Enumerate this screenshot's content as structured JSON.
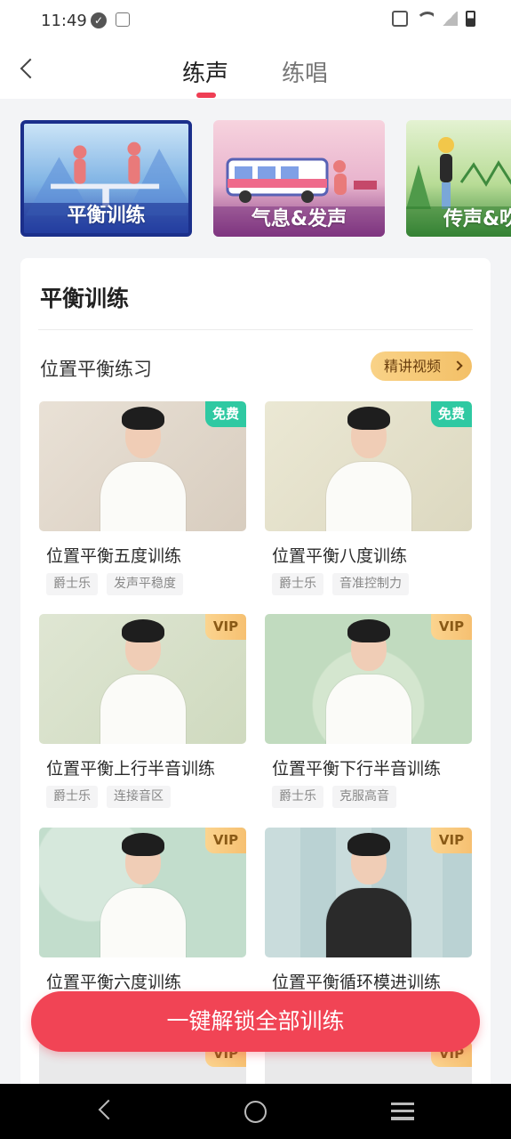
{
  "status_bar": {
    "time": "11:49"
  },
  "header": {
    "tabs": [
      {
        "label": "练声",
        "active": true
      },
      {
        "label": "练唱",
        "active": false
      }
    ],
    "accent_color": "#ef3e54"
  },
  "categories": [
    {
      "label": "平衡训练",
      "selected": true
    },
    {
      "label": "气息&发声",
      "selected": false
    },
    {
      "label": "传声&吹",
      "selected": false
    }
  ],
  "panel": {
    "title": "平衡训练",
    "section_title": "位置平衡练习",
    "video_button": "精讲视频"
  },
  "courses": [
    {
      "name": "位置平衡五度训练",
      "badge": "免费",
      "tags": [
        "爵士乐",
        "发声平稳度"
      ]
    },
    {
      "name": "位置平衡八度训练",
      "badge": "免费",
      "tags": [
        "爵士乐",
        "音准控制力"
      ]
    },
    {
      "name": "位置平衡上行半音训练",
      "badge": "VIP",
      "tags": [
        "爵士乐",
        "连接音区"
      ]
    },
    {
      "name": "位置平衡下行半音训练",
      "badge": "VIP",
      "tags": [
        "爵士乐",
        "克服高音"
      ]
    },
    {
      "name": "位置平衡六度训练",
      "badge": "VIP",
      "tags": []
    },
    {
      "name": "位置平衡循环模进训练",
      "badge": "VIP",
      "tags": []
    },
    {
      "name": "",
      "badge": "VIP",
      "tags": []
    },
    {
      "name": "",
      "badge": "VIP",
      "tags": []
    }
  ],
  "unlock_button": "一键解锁全部训练",
  "colors": {
    "free_badge": "#2fc9a2",
    "vip_badge": "#f6c071",
    "unlock": "#f14455"
  }
}
